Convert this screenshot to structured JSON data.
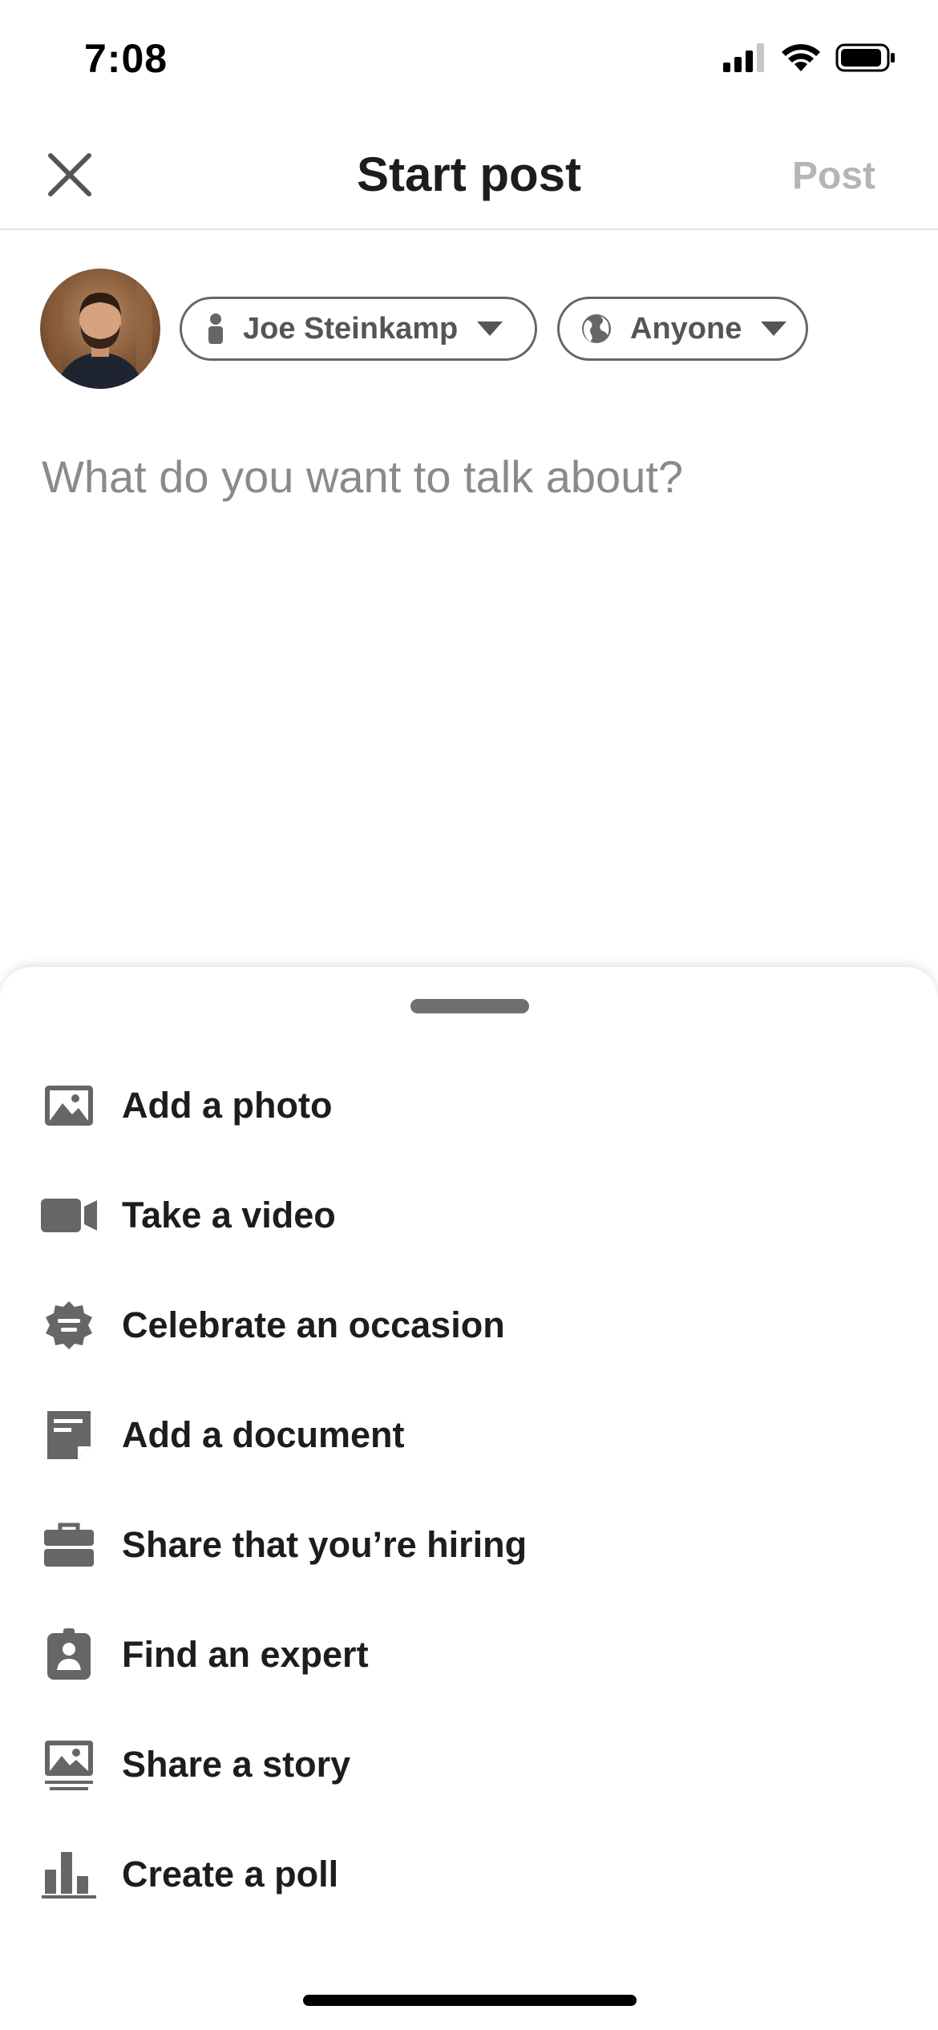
{
  "status_bar": {
    "time": "7:08",
    "icons": [
      "cellular-signal-icon",
      "wifi-icon",
      "battery-icon"
    ]
  },
  "header": {
    "title": "Start post",
    "post_label": "Post",
    "close_icon": "close-icon"
  },
  "composer": {
    "author_name": "Joe Steinkamp",
    "visibility": "Anyone",
    "prompt_placeholder": "What do you want to talk about?"
  },
  "sheet": {
    "items": [
      {
        "icon": "photo-icon",
        "label": "Add a photo"
      },
      {
        "icon": "video-camera-icon",
        "label": "Take a video"
      },
      {
        "icon": "celebration-badge-icon",
        "label": "Celebrate an occasion"
      },
      {
        "icon": "document-icon",
        "label": "Add a document"
      },
      {
        "icon": "briefcase-icon",
        "label": "Share that you’re hiring"
      },
      {
        "icon": "expert-badge-icon",
        "label": "Find an expert"
      },
      {
        "icon": "story-icon",
        "label": "Share a story"
      },
      {
        "icon": "poll-chart-icon",
        "label": "Create a poll"
      }
    ]
  },
  "colors": {
    "icon_gray": "#666666",
    "text": "#1d1d1d",
    "disabled": "#b5b5b5",
    "placeholder": "#8a8a8a"
  }
}
